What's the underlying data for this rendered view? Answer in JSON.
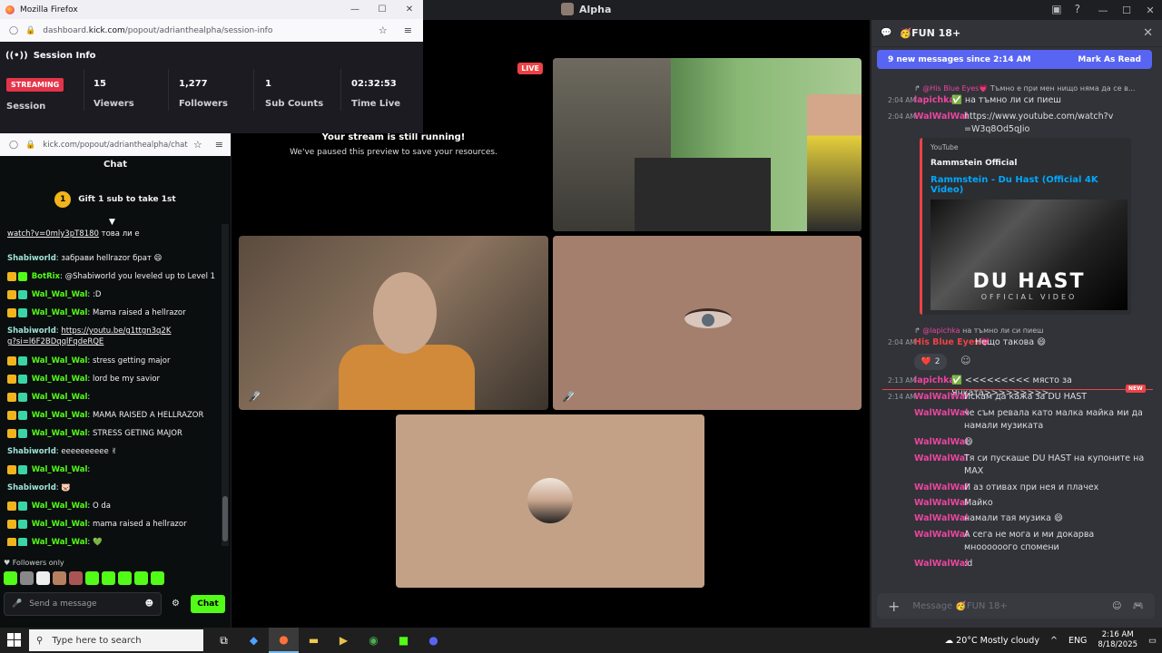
{
  "discord": {
    "window_title": "Alpha",
    "stage": {
      "live_badge": "LIVE",
      "paused_title": "Your stream is still running!",
      "paused_subtitle": "We've paused this preview to save your resources."
    },
    "chat": {
      "channel_name": "🥳FUN 18+",
      "new_messages": "9 new messages since 2:14 AM",
      "mark_as_read": "Mark As Read",
      "input_placeholder": "Message 🥳FUN 18+",
      "new_tag": "NEW",
      "messages": [
        {
          "reply_user": "@His Blue Eyes💗",
          "reply_text": "Тъмно е при мен нищо няма да се в...",
          "time": "2:04 AM",
          "user": "lapichka",
          "badge": "✅",
          "text": "на тъмно ли си пиеш"
        },
        {
          "time": "2:04 AM",
          "user": "WalWalWal",
          "link": "https://www.youtube.com/watch?v=W3q8Od5qJio"
        },
        {
          "reply_user": "@lapichka",
          "reply_text": "на тъмно ли си пиеш",
          "time": "2:04 AM",
          "user": "His Blue Eyes💗",
          "text": "Нещо такова 😄"
        },
        {
          "time": "2:13 AM",
          "user": "lapichka",
          "badge": "✅",
          "text": "<<<<<<<<< място за Янката>>>>>>>>>"
        },
        {
          "time": "2:14 AM",
          "user": "WalWalWal",
          "text": "Искам да кажа за DU HAST"
        },
        {
          "user": "WalWalWal",
          "text": "че съм ревала като малка майка ми да намали музиката"
        },
        {
          "user": "WalWalWal",
          "text": "😄"
        },
        {
          "user": "WalWalWal",
          "text": "Тя си пускаше DU HAST на купоните на MAX"
        },
        {
          "user": "WalWalWal",
          "text": "И аз отивах при нея и плачех"
        },
        {
          "user": "WalWalWal",
          "text": "Майко"
        },
        {
          "user": "WalWalWal",
          "text": "намали тая музика 😄"
        },
        {
          "user": "WalWalWal",
          "text": "А сега не мога и ми докарва мноооооого спомени"
        },
        {
          "user": "WalWalWal",
          "text": ":d"
        }
      ],
      "embed": {
        "provider": "YouTube",
        "author": "Rammstein Official",
        "title": "Rammstein - Du Hast (Official 4K Video)",
        "thumb_text": "DU HAST",
        "thumb_sub": "OFFICIAL VIDEO"
      },
      "reaction": {
        "emoji": "❤️",
        "count": "2"
      }
    }
  },
  "firefox1": {
    "title": "Mozilla Firefox",
    "url_prefix": "dashboard.",
    "url_domain": "kick.com",
    "url_rest": "/popout/adrianthealpha/session-info",
    "section_title": "Session Info",
    "streaming_badge": "STREAMING",
    "session_label": "Session",
    "stats": [
      {
        "value": "15",
        "label": "Viewers"
      },
      {
        "value": "1,277",
        "label": "Followers"
      },
      {
        "value": "1",
        "label": "Sub Counts"
      },
      {
        "value": "02:32:53",
        "label": "Time Live"
      }
    ]
  },
  "firefox2": {
    "url": "kick.com/popout/adrianthealpha/chat",
    "chat_title": "Chat",
    "gift_rank": "1",
    "gift_text": "Gift 1 sub to take 1st",
    "followers_only": "Followers only",
    "input_placeholder": "Send a message",
    "chat_button": "Chat",
    "messages": [
      {
        "kind": "link-tail",
        "text": "watch?v=0mly3pT8180",
        "after": " това ли е"
      },
      {
        "kind": "shab",
        "user": "Shabiworld",
        "text": "забрави hellrazor брат 😄"
      },
      {
        "kind": "bot",
        "user": "BotRix",
        "text": "@Shabiworld you leveled up to Level 1"
      },
      {
        "kind": "wal",
        "user": "Wal_Wal_Wal",
        "text": ":D"
      },
      {
        "kind": "wal",
        "user": "Wal_Wal_Wal",
        "text": "Mama raised a hellrazor"
      },
      {
        "kind": "shablink",
        "user": "Shabiworld",
        "text": "https://youtu.be/g1ttgn3q2Kg?si=l6F2BDqqlFqdeRQE"
      },
      {
        "kind": "wal",
        "user": "Wal_Wal_Wal",
        "text": "stress getting major"
      },
      {
        "kind": "wal",
        "user": "Wal_Wal_Wal",
        "text": "lord be my savior"
      },
      {
        "kind": "wal",
        "user": "Wal_Wal_Wal",
        "text": ""
      },
      {
        "kind": "wal",
        "user": "Wal_Wal_Wal",
        "text": "MAMA RAISED A HELLRAZOR"
      },
      {
        "kind": "wal",
        "user": "Wal_Wal_Wal",
        "text": "STRESS GETING MAJOR"
      },
      {
        "kind": "shab",
        "user": "Shabiworld",
        "text": "eeeeeeeeee ✌"
      },
      {
        "kind": "wal",
        "user": "Wal_Wal_Wal",
        "text": ""
      },
      {
        "kind": "shab",
        "user": "Shabiworld",
        "text": "🐷"
      },
      {
        "kind": "wal",
        "user": "Wal_Wal_Wal",
        "text": "O da"
      },
      {
        "kind": "wal",
        "user": "Wal_Wal_Wal",
        "text": "mama raised a hellrazor"
      },
      {
        "kind": "wal",
        "user": "Wal_Wal_Wal",
        "text": "💚"
      }
    ]
  },
  "taskbar": {
    "search_placeholder": "Type here to search",
    "weather": "20°C  Mostly cloudy",
    "lang": "ENG",
    "time": "2:16 AM",
    "date": "8/18/2025"
  }
}
